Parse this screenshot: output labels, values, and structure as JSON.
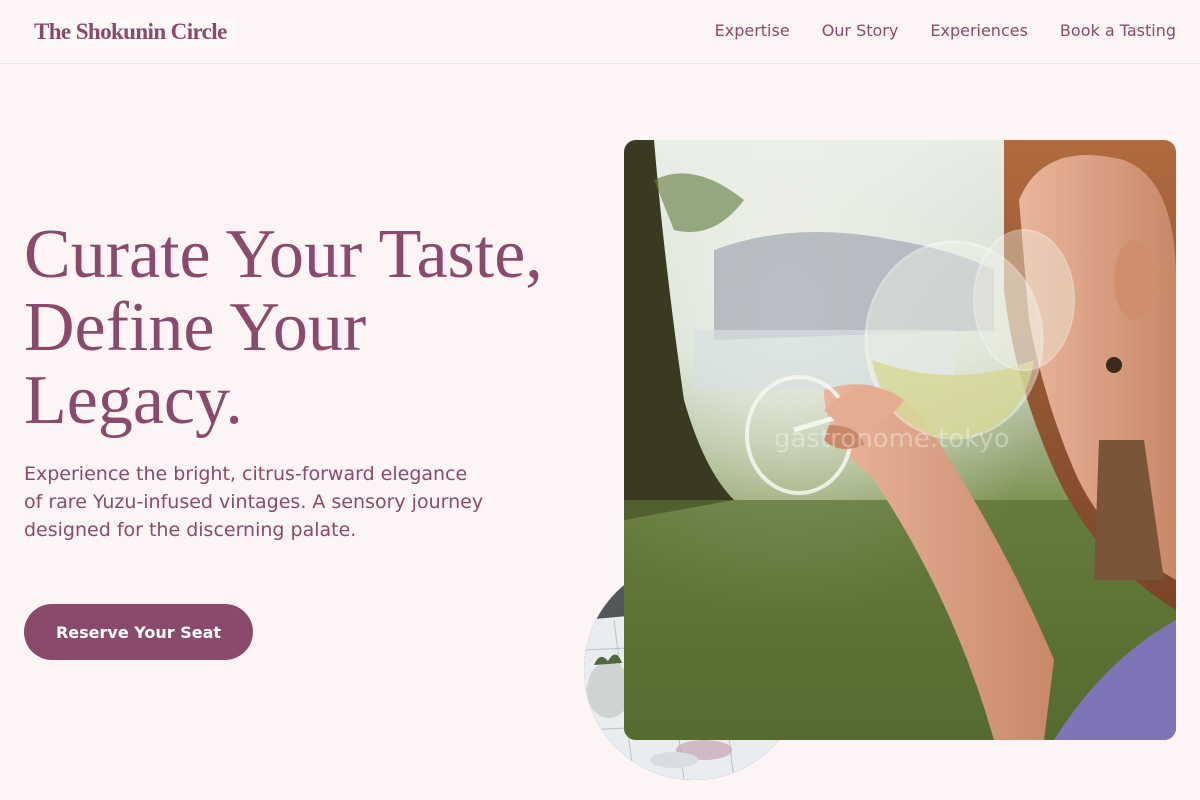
{
  "brand": {
    "name": "The Shokunin Circle"
  },
  "nav": {
    "links": [
      "Expertise",
      "Our Story",
      "Experiences",
      "Book a Tasting"
    ]
  },
  "hero": {
    "title_lines": [
      "Curate Your Taste,",
      "Define Your",
      "Legacy."
    ],
    "subtitle": "Experience the bright, citrus-forward elegance of rare Yuzu-infused vintages. A sensory journey designed for the discerning palate.",
    "cta_label": "Reserve Your Seat"
  },
  "photo": {
    "watermark": "gastronome.tokyo"
  },
  "colors": {
    "accent": "#8a4a6b",
    "background": "#fdf4f5",
    "button_text": "#ffffff"
  }
}
